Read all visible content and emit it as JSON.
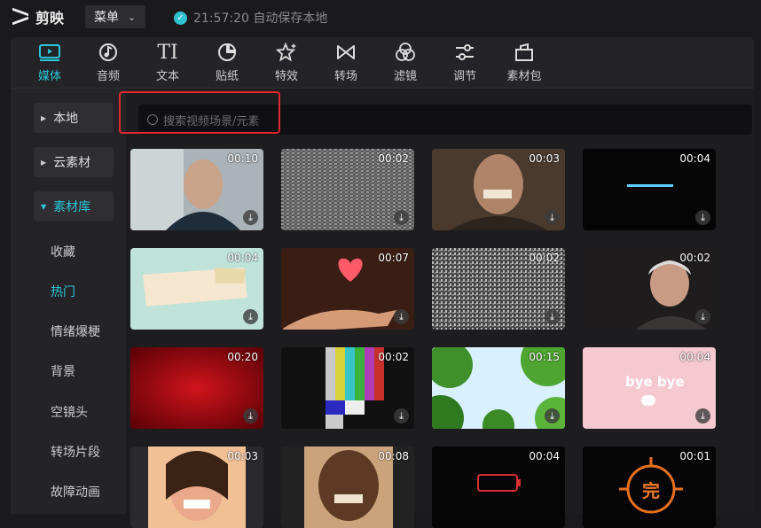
{
  "app": {
    "name": "剪映"
  },
  "topbar": {
    "menu_label": "菜单",
    "autosave_text": "21:57:20 自动保存本地"
  },
  "toolbar": {
    "tabs": [
      {
        "label": "媒体",
        "icon": "media-icon",
        "active": true
      },
      {
        "label": "音频",
        "icon": "audio-icon"
      },
      {
        "label": "文本",
        "icon": "text-icon",
        "glyph": "TI"
      },
      {
        "label": "贴纸",
        "icon": "sticker-icon"
      },
      {
        "label": "特效",
        "icon": "effects-icon"
      },
      {
        "label": "转场",
        "icon": "transition-icon"
      },
      {
        "label": "滤镜",
        "icon": "filter-icon"
      },
      {
        "label": "调节",
        "icon": "adjust-icon"
      },
      {
        "label": "素材包",
        "icon": "material-pack-icon"
      }
    ]
  },
  "sidebar": {
    "sections": [
      {
        "label": "本地"
      },
      {
        "label": "云素材"
      },
      {
        "label": "素材库",
        "active": true
      }
    ],
    "sub_items": [
      {
        "label": "收藏"
      },
      {
        "label": "热门",
        "active": true
      },
      {
        "label": "情绪爆梗"
      },
      {
        "label": "背景"
      },
      {
        "label": "空镜头"
      },
      {
        "label": "转场片段"
      },
      {
        "label": "故障动画"
      }
    ]
  },
  "search": {
    "placeholder": "搜索视频场景/元素"
  },
  "grid": {
    "items": [
      {
        "duration": "00:10",
        "theme": "person-man-gray"
      },
      {
        "duration": "00:02",
        "theme": "static-noise"
      },
      {
        "duration": "00:03",
        "theme": "laughing-man"
      },
      {
        "duration": "00:04",
        "theme": "dark-loading"
      },
      {
        "duration": "00:04",
        "theme": "paper-note"
      },
      {
        "duration": "00:07",
        "theme": "heart-hand"
      },
      {
        "duration": "00:02",
        "theme": "noise-2"
      },
      {
        "duration": "00:02",
        "theme": "old-woman"
      },
      {
        "duration": "00:20",
        "theme": "red-bg"
      },
      {
        "duration": "00:02",
        "theme": "color-bars"
      },
      {
        "duration": "00:15",
        "theme": "green-leaves"
      },
      {
        "duration": "00:04",
        "theme": "bye-bye"
      },
      {
        "duration": "00:03",
        "theme": "laughing-woman"
      },
      {
        "duration": "00:08",
        "theme": "crying-man"
      },
      {
        "duration": "00:04",
        "theme": "battery"
      },
      {
        "duration": "00:01",
        "theme": "wan-stamp"
      }
    ],
    "bye_text": "bye bye",
    "wan_text": "完"
  },
  "colors": {
    "accent": "#29c8d8",
    "highlight_box": "#e0282e"
  }
}
